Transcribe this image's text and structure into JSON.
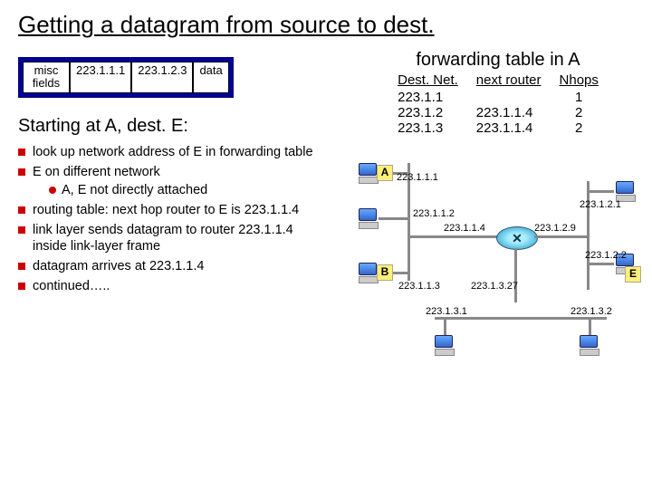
{
  "title": "Getting a datagram from source to dest.",
  "datagram": {
    "misc_top": "misc",
    "misc_bottom": "fields",
    "src": "223.1.1.1",
    "dst": "223.1.2.3",
    "data": "data"
  },
  "subhead": "Starting at A, dest. E:",
  "bullets": [
    "look up network address of E in forwarding table",
    "E on different network",
    "routing table: next hop router to E is 223.1.1.4",
    "link layer sends datagram to router 223.1.1.4 inside link-layer frame",
    "datagram arrives at 223.1.1.4",
    "continued….."
  ],
  "sub_bullet": "A, E not directly attached",
  "fwd_title": "forwarding table in A",
  "fwd_headers": [
    "Dest. Net.",
    "next router",
    "Nhops"
  ],
  "fwd_rows": [
    [
      "223.1.1",
      "",
      "1"
    ],
    [
      "223.1.2",
      "223.1.1.4",
      "2"
    ],
    [
      "223.1.3",
      "223.1.1.4",
      "2"
    ]
  ],
  "net_labels": {
    "a": "A",
    "b": "B",
    "e": "E",
    "ip_111": "223.1.1.1",
    "ip_112": "223.1.1.2",
    "ip_113": "223.1.1.3",
    "ip_114": "223.1.1.4",
    "ip_121": "223.1.2.1",
    "ip_122": "223.1.2.2",
    "ip_129": "223.1.2.9",
    "ip_131": "223.1.3.1",
    "ip_132": "223.1.3.2",
    "ip_1327": "223.1.3.27"
  },
  "colors": {
    "accent_red": "#cc0000",
    "accent_blue": "#000080"
  }
}
